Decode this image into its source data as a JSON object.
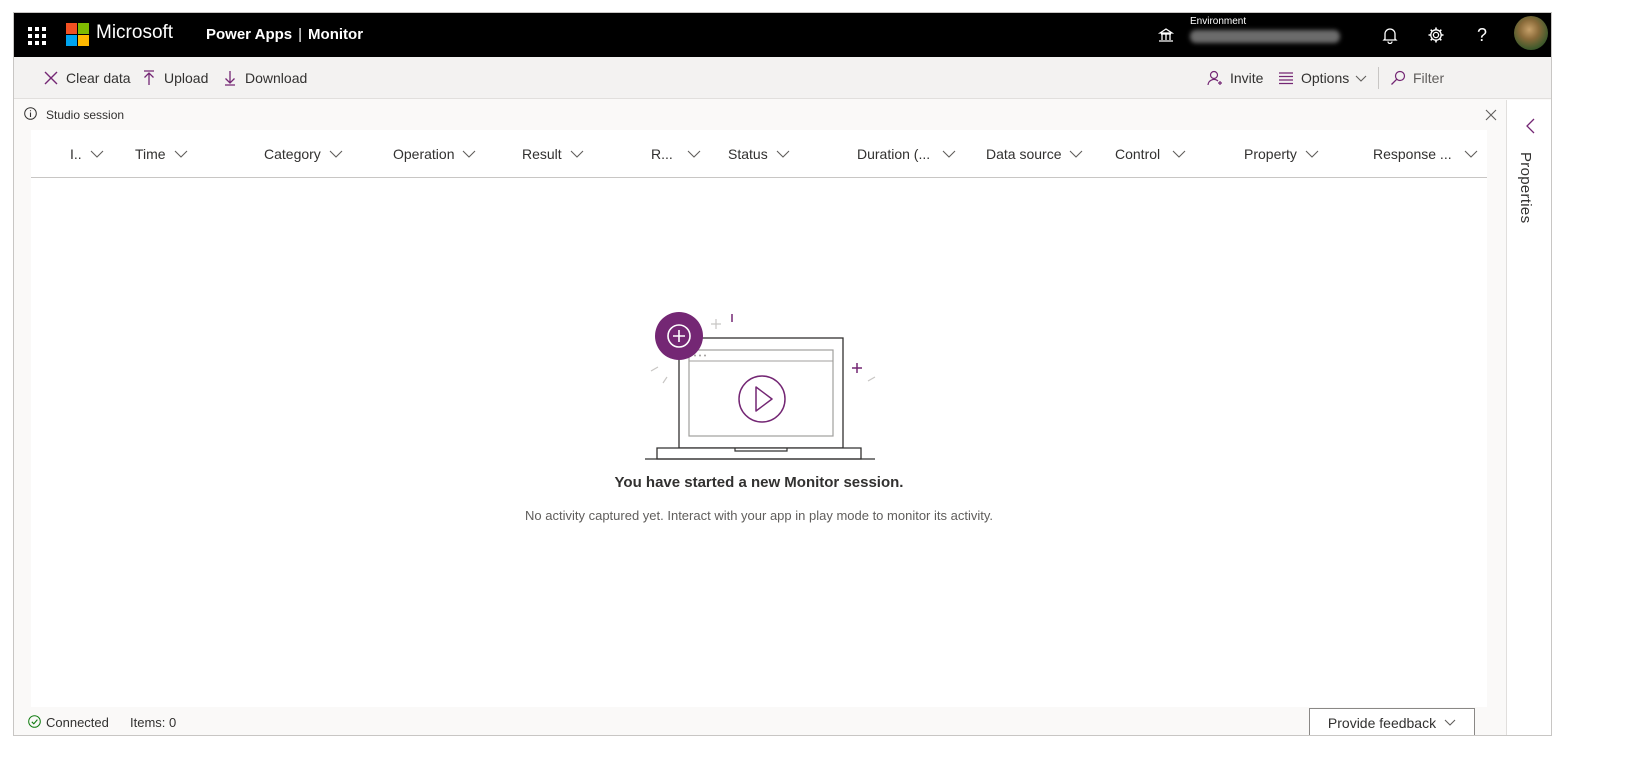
{
  "topbar": {
    "brand": "Microsoft",
    "app": "Power Apps",
    "separator": "|",
    "page": "Monitor",
    "environment_label": "Environment",
    "icons": [
      "waffle-icon",
      "environment-icon",
      "bell-icon",
      "gear-icon",
      "help-icon",
      "avatar"
    ]
  },
  "colors": {
    "topbar_bg": "#000000",
    "accent": "#742774",
    "ms_red": "#f25022",
    "ms_green": "#7fba00",
    "ms_blue": "#00a4ef",
    "ms_yellow": "#ffb900"
  },
  "commands": {
    "clear": "Clear data",
    "upload": "Upload",
    "download": "Download",
    "invite": "Invite",
    "options": "Options",
    "filter": "Filter"
  },
  "session": {
    "label": "Studio session"
  },
  "columns": [
    "I..",
    "Time",
    "Category",
    "Operation",
    "Result",
    "R...",
    "Status",
    "Duration (...",
    "Data source",
    "Control",
    "Property",
    "Response ..."
  ],
  "empty_state": {
    "title": "You have started a new Monitor session.",
    "subtitle": "No activity captured yet. Interact with your app in play mode to monitor its activity."
  },
  "status": {
    "connected": "Connected",
    "items": "Items: 0",
    "feedback": "Provide feedback"
  },
  "properties_pane": {
    "label": "Properties"
  }
}
